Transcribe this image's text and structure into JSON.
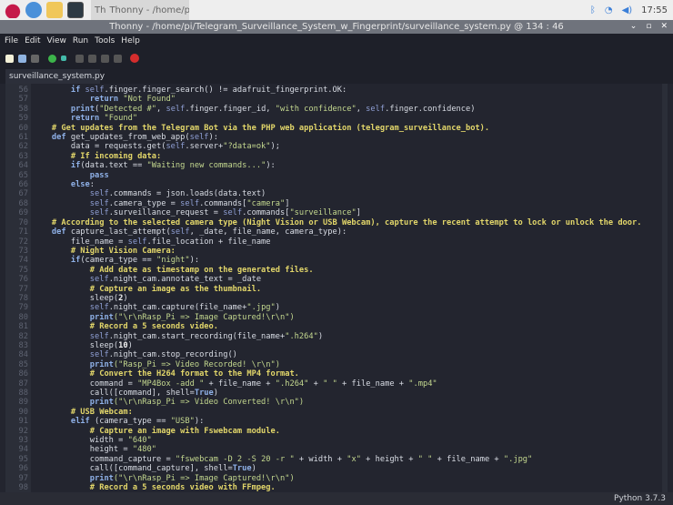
{
  "taskbar": {
    "app_label": "Thonny - /home/pi/T...",
    "clock": "17:55",
    "icons": [
      "raspberry-menu-icon",
      "browser-icon",
      "file-manager-icon",
      "terminal-icon",
      "bluetooth-icon",
      "wifi-icon",
      "volume-icon"
    ]
  },
  "window": {
    "title": "Thonny - /home/pi/Telegram_Surveillance_System_w_Fingerprint/surveillance_system.py @ 134 : 46",
    "buttons": [
      "⌄",
      "▫",
      "✕"
    ]
  },
  "menu": [
    "File",
    "Edit",
    "View",
    "Run",
    "Tools",
    "Help"
  ],
  "toolbar": [
    "new",
    "open",
    "save",
    "run",
    "debug",
    "step-over",
    "step-into",
    "step-out",
    "resume",
    "stop"
  ],
  "tab": {
    "label": "surveillance_system.py",
    "close": "×"
  },
  "status": {
    "interpreter": "Python 3.7.3"
  },
  "colors": {
    "keyword": "#8fb1e8",
    "string": "#c4d88f",
    "comment": "#e2d66a",
    "background": "#23252f"
  },
  "code": [
    {
      "n": 56,
      "i": 8,
      "t": [
        [
          "k",
          "if "
        ],
        [
          "s",
          "self"
        ],
        [
          "p",
          ".finger.finger_search() != adafruit_fingerprint.OK:"
        ]
      ]
    },
    {
      "n": 57,
      "i": 12,
      "t": [
        [
          "k",
          "return "
        ],
        [
          "t",
          "\"Not Found\""
        ]
      ]
    },
    {
      "n": 58,
      "i": 8,
      "t": [
        [
          "k",
          "print"
        ],
        [
          "p",
          "("
        ],
        [
          "t",
          "\"Detected #\""
        ],
        [
          "p",
          ", "
        ],
        [
          "s",
          "self"
        ],
        [
          "p",
          ".finger.finger_id, "
        ],
        [
          "t",
          "\"with confidence\""
        ],
        [
          "p",
          ", "
        ],
        [
          "s",
          "self"
        ],
        [
          "p",
          ".finger.confidence)"
        ]
      ]
    },
    {
      "n": 59,
      "i": 8,
      "t": [
        [
          "k",
          "return "
        ],
        [
          "t",
          "\"Found\""
        ]
      ]
    },
    {
      "n": 60,
      "i": 4,
      "t": [
        [
          "c",
          "# Get updates from the Telegram Bot via the PHP web application (telegram_surveillance_bot)."
        ]
      ]
    },
    {
      "n": 61,
      "i": 4,
      "t": [
        [
          "k",
          "def "
        ],
        [
          "p",
          "get_updates_from_web_app("
        ],
        [
          "s",
          "self"
        ],
        [
          "p",
          "):"
        ]
      ]
    },
    {
      "n": 62,
      "i": 8,
      "t": [
        [
          "p",
          "data = requests.get("
        ],
        [
          "s",
          "self"
        ],
        [
          "p",
          ".server+"
        ],
        [
          "t",
          "\"?data=ok\""
        ],
        [
          "p",
          ");"
        ]
      ]
    },
    {
      "n": 63,
      "i": 8,
      "t": [
        [
          "c",
          "# If incoming data:"
        ]
      ]
    },
    {
      "n": 64,
      "i": 8,
      "t": [
        [
          "k",
          "if"
        ],
        [
          "p",
          "(data.text == "
        ],
        [
          "t",
          "\"Waiting new commands...\""
        ],
        [
          "p",
          "):"
        ]
      ]
    },
    {
      "n": 65,
      "i": 12,
      "t": [
        [
          "k",
          "pass"
        ]
      ]
    },
    {
      "n": 66,
      "i": 8,
      "t": [
        [
          "k",
          "else"
        ],
        [
          "p",
          ":"
        ]
      ]
    },
    {
      "n": 67,
      "i": 12,
      "t": [
        [
          "s",
          "self"
        ],
        [
          "p",
          ".commands = json.loads(data.text)"
        ]
      ]
    },
    {
      "n": 68,
      "i": 12,
      "t": [
        [
          "s",
          "self"
        ],
        [
          "p",
          ".camera_type = "
        ],
        [
          "s",
          "self"
        ],
        [
          "p",
          ".commands["
        ],
        [
          "t",
          "\"camera\""
        ],
        [
          "p",
          "]"
        ]
      ]
    },
    {
      "n": 69,
      "i": 12,
      "t": [
        [
          "s",
          "self"
        ],
        [
          "p",
          ".surveillance_request = "
        ],
        [
          "s",
          "self"
        ],
        [
          "p",
          ".commands["
        ],
        [
          "t",
          "\"surveillance\""
        ],
        [
          "p",
          "]"
        ]
      ]
    },
    {
      "n": 70,
      "i": 4,
      "t": [
        [
          "c",
          "# According to the selected camera type (Night Vision or USB Webcam), capture the recent attempt to lock or unlock the door."
        ]
      ]
    },
    {
      "n": 71,
      "i": 4,
      "t": [
        [
          "k",
          "def "
        ],
        [
          "p",
          "capture_last_attempt("
        ],
        [
          "s",
          "self"
        ],
        [
          "p",
          ", _date, file_name, camera_type):"
        ]
      ]
    },
    {
      "n": 72,
      "i": 8,
      "t": [
        [
          "p",
          "file_name = "
        ],
        [
          "s",
          "self"
        ],
        [
          "p",
          ".file_location + file_name"
        ]
      ]
    },
    {
      "n": 73,
      "i": 8,
      "t": [
        [
          "c",
          "# Night Vision Camera:"
        ]
      ]
    },
    {
      "n": 74,
      "i": 8,
      "t": [
        [
          "k",
          "if"
        ],
        [
          "p",
          "(camera_type == "
        ],
        [
          "t",
          "\"night\""
        ],
        [
          "p",
          "):"
        ]
      ]
    },
    {
      "n": 75,
      "i": 12,
      "t": [
        [
          "c",
          "# Add date as timestamp on the generated files."
        ]
      ]
    },
    {
      "n": 76,
      "i": 12,
      "t": [
        [
          "s",
          "self"
        ],
        [
          "p",
          ".night_cam.annotate_text = _date"
        ]
      ]
    },
    {
      "n": 77,
      "i": 12,
      "t": [
        [
          "c",
          "# Capture an image as the thumbnail."
        ]
      ]
    },
    {
      "n": 78,
      "i": 12,
      "t": [
        [
          "p",
          "sleep("
        ],
        [
          "n",
          "2"
        ],
        [
          "p",
          ")"
        ]
      ]
    },
    {
      "n": 79,
      "i": 12,
      "t": [
        [
          "s",
          "self"
        ],
        [
          "p",
          ".night_cam.capture(file_name+"
        ],
        [
          "t",
          "\".jpg\""
        ],
        [
          "p",
          ")"
        ]
      ]
    },
    {
      "n": 80,
      "i": 12,
      "t": [
        [
          "k",
          "print"
        ],
        [
          "t",
          "(\"\\r\\nRasp_Pi => Image Captured!\\r\\n\")"
        ]
      ]
    },
    {
      "n": 81,
      "i": 12,
      "t": [
        [
          "c",
          "# Record a 5 seconds video."
        ]
      ]
    },
    {
      "n": 82,
      "i": 12,
      "t": [
        [
          "s",
          "self"
        ],
        [
          "p",
          ".night_cam.start_recording(file_name+"
        ],
        [
          "t",
          "\".h264\""
        ],
        [
          "p",
          ")"
        ]
      ]
    },
    {
      "n": 83,
      "i": 12,
      "t": [
        [
          "p",
          "sleep("
        ],
        [
          "n",
          "10"
        ],
        [
          "p",
          ")"
        ]
      ]
    },
    {
      "n": 84,
      "i": 12,
      "t": [
        [
          "s",
          "self"
        ],
        [
          "p",
          ".night_cam.stop_recording()"
        ]
      ]
    },
    {
      "n": 85,
      "i": 12,
      "t": [
        [
          "k",
          "print"
        ],
        [
          "t",
          "(\"Rasp_Pi => Video Recorded! \\r\\n\")"
        ]
      ]
    },
    {
      "n": 86,
      "i": 12,
      "t": [
        [
          "c",
          "# Convert the H264 format to the MP4 format."
        ]
      ]
    },
    {
      "n": 87,
      "i": 12,
      "t": [
        [
          "p",
          "command = "
        ],
        [
          "t",
          "\"MP4Box -add \""
        ],
        [
          "p",
          " + file_name + "
        ],
        [
          "t",
          "\".h264\""
        ],
        [
          "p",
          " + "
        ],
        [
          "t",
          "\" \""
        ],
        [
          "p",
          " + file_name + "
        ],
        [
          "t",
          "\".mp4\""
        ]
      ]
    },
    {
      "n": 88,
      "i": 12,
      "t": [
        [
          "p",
          "call([command], shell="
        ],
        [
          "k",
          "True"
        ],
        [
          "p",
          ")"
        ]
      ]
    },
    {
      "n": 89,
      "i": 12,
      "t": [
        [
          "k",
          "print"
        ],
        [
          "t",
          "(\"\\r\\nRasp_Pi => Video Converted! \\r\\n\")"
        ]
      ]
    },
    {
      "n": 90,
      "i": 8,
      "t": [
        [
          "c",
          "# USB Webcam:"
        ]
      ]
    },
    {
      "n": 91,
      "i": 8,
      "t": [
        [
          "k",
          "elif "
        ],
        [
          "p",
          "(camera_type == "
        ],
        [
          "t",
          "\"USB\""
        ],
        [
          "p",
          "):"
        ]
      ]
    },
    {
      "n": 92,
      "i": 12,
      "t": [
        [
          "c",
          "# Capture an image with Fswebcam module."
        ]
      ]
    },
    {
      "n": 93,
      "i": 12,
      "t": [
        [
          "p",
          "width = "
        ],
        [
          "t",
          "\"640\""
        ]
      ]
    },
    {
      "n": 94,
      "i": 12,
      "t": [
        [
          "p",
          "height = "
        ],
        [
          "t",
          "\"480\""
        ]
      ]
    },
    {
      "n": 95,
      "i": 12,
      "t": [
        [
          "p",
          "command_capture = "
        ],
        [
          "t",
          "\"fswebcam -D 2 -S 20 -r \""
        ],
        [
          "p",
          " + width + "
        ],
        [
          "t",
          "\"x\""
        ],
        [
          "p",
          " + height + "
        ],
        [
          "t",
          "\" \""
        ],
        [
          "p",
          " + file_name + "
        ],
        [
          "t",
          "\".jpg\""
        ]
      ]
    },
    {
      "n": 96,
      "i": 12,
      "t": [
        [
          "p",
          "call([command_capture], shell="
        ],
        [
          "k",
          "True"
        ],
        [
          "p",
          ")"
        ]
      ]
    },
    {
      "n": 97,
      "i": 12,
      "t": [
        [
          "k",
          "print"
        ],
        [
          "t",
          "(\"\\r\\nRasp_Pi => Image Captured!\\r\\n\")"
        ]
      ]
    },
    {
      "n": 98,
      "i": 12,
      "t": [
        [
          "c",
          "# Record a 5 seconds video with FFmpeg."
        ]
      ]
    }
  ]
}
